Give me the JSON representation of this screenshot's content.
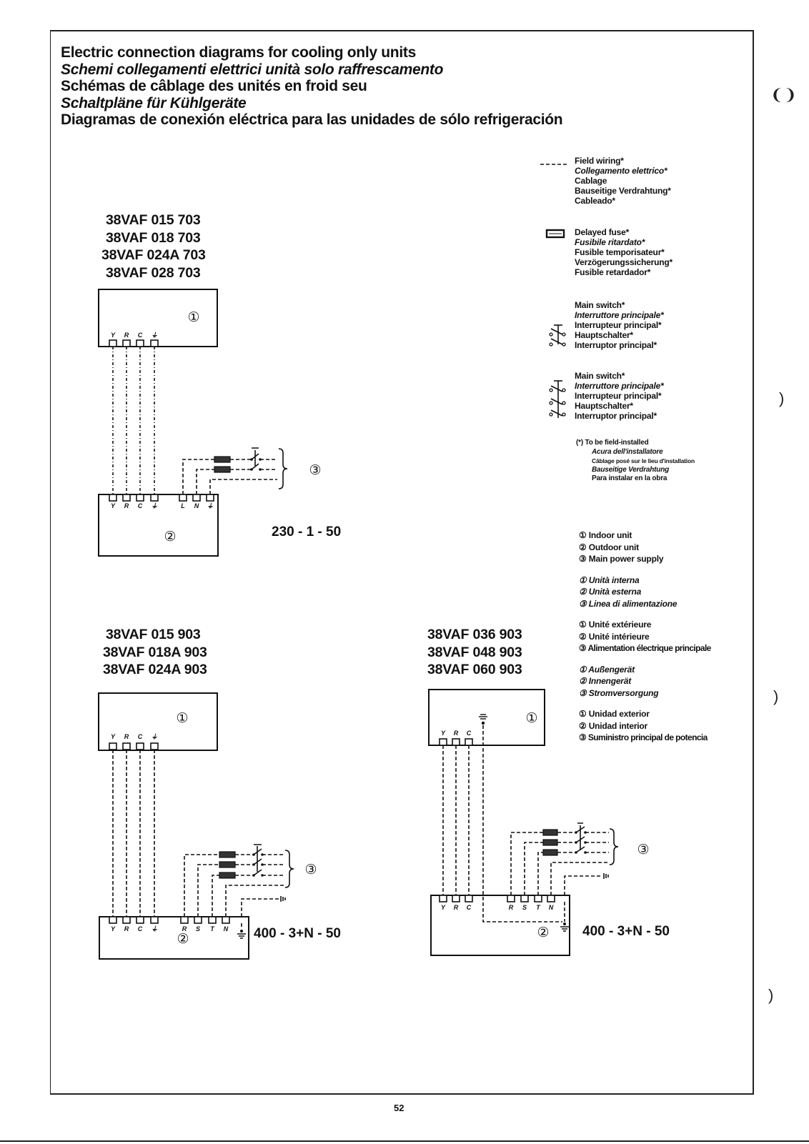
{
  "titles": [
    {
      "text": "Electric connection diagrams for cooling only units",
      "italic": false
    },
    {
      "text": "Schemi collegamenti elettrici unità solo raffrescamento",
      "italic": true
    },
    {
      "text": "Schémas de câblage des unités en froid seu",
      "italic": false
    },
    {
      "text": "Schaltpläne für Kühlgeräte",
      "italic": true
    },
    {
      "text": "Diagramas de conexión eléctrica para las unidades de sólo refrigeración",
      "italic": false
    }
  ],
  "diagrams": [
    {
      "models": [
        "38VAF 015 703",
        "38VAF 018 703",
        "38VAF 024A 703",
        "38VAF 028 703"
      ],
      "indoor_label": "①",
      "outdoor_label": "②",
      "supply_label": "③",
      "indoor_terminals": [
        "Y",
        "R",
        "C",
        "⏚"
      ],
      "outdoor_terminals": [
        "Y",
        "R",
        "C",
        "⏚",
        "L",
        "N",
        "⏚"
      ],
      "voltage": "230 - 1 - 50"
    },
    {
      "models": [
        "38VAF 015 903",
        "38VAF 018A 903",
        "38VAF 024A 903"
      ],
      "indoor_label": "①",
      "outdoor_label": "②",
      "supply_label": "③",
      "indoor_terminals": [
        "Y",
        "R",
        "C",
        "⏚"
      ],
      "outdoor_terminals": [
        "Y",
        "R",
        "C",
        "⏚",
        "R",
        "S",
        "T",
        "N"
      ],
      "voltage": "400 - 3+N - 50"
    },
    {
      "models": [
        "38VAF 036 903",
        "38VAF 048 903",
        "38VAF 060 903"
      ],
      "indoor_label": "①",
      "outdoor_label": "②",
      "supply_label": "③",
      "indoor_terminals": [
        "Y",
        "R",
        "C"
      ],
      "outdoor_terminals": [
        "Y",
        "R",
        "C",
        "R",
        "S",
        "T",
        "N"
      ],
      "voltage": "400 - 3+N - 50"
    }
  ],
  "legend": {
    "field_wiring": [
      "Field wiring*",
      "Collegamento elettrico*",
      "Cablage",
      "Bauseitige Verdrahtung*",
      "Cableado*"
    ],
    "delayed_fuse": [
      "Delayed fuse*",
      "Fusibile ritardato*",
      "Fusible temporisateur*",
      "Verzögerungssicherung*",
      "Fusible retardador*"
    ],
    "main_switch_1ph": [
      "Main switch*",
      "Interruttore principale*",
      "Interrupteur principal*",
      "Hauptschalter*",
      "Interruptor principal*"
    ],
    "main_switch_3ph": [
      "Main switch*",
      "Interruttore principale*",
      "Interrupteur principal*",
      "Hauptschalter*",
      "Interruptor principal*"
    ],
    "field_installed": {
      "header": "(*) To be field-installed",
      "lines": [
        "Acura dell'installatore",
        "Câblage posé sur le lieu d'installation",
        "Bauseitige Verdrahtung",
        "Para instalar en la obra"
      ]
    },
    "units": [
      [
        "① Indoor unit",
        "② Outdoor unit",
        "③ Main power supply"
      ],
      [
        "① Unità interna",
        "② Unità esterna",
        "③ Linea di alimentazione"
      ],
      [
        "① Unité extérieure",
        "② Unité intérieure",
        "③ Alimentation électrique principale"
      ],
      [
        "① Außengerät",
        "② Innengerät",
        "③ Stromversorgung"
      ],
      [
        "① Unidad exterior",
        "② Unidad interior",
        "③ Suministro principal de potencia"
      ]
    ]
  },
  "page_number": "52"
}
